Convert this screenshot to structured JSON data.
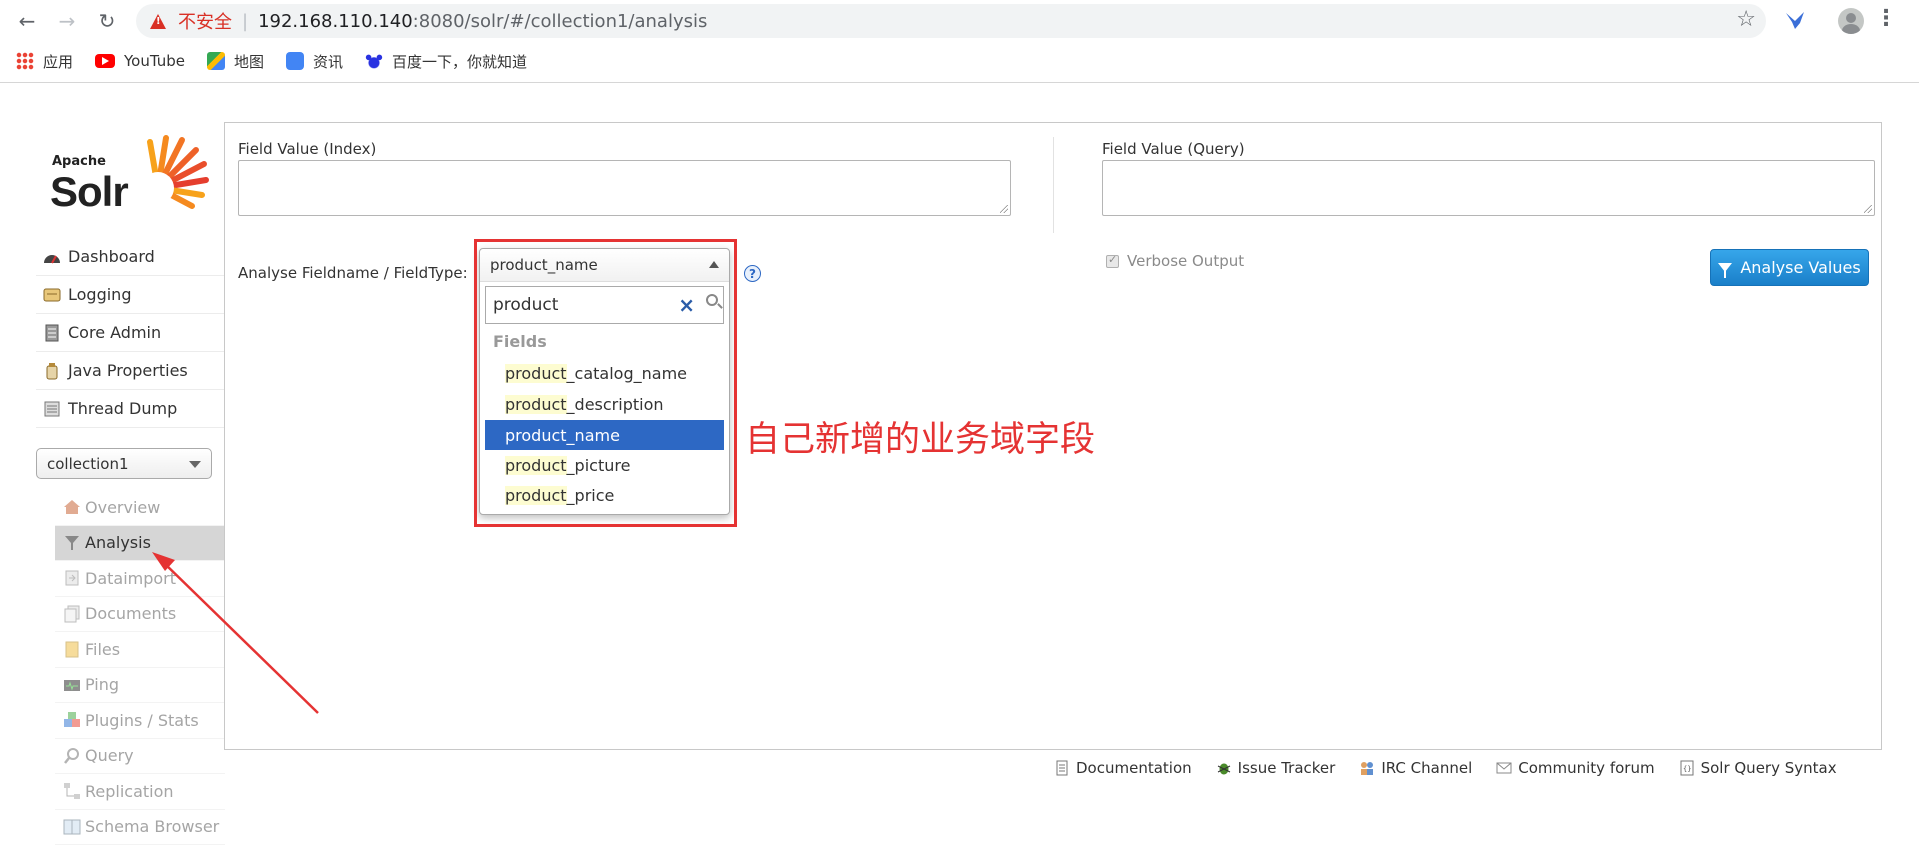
{
  "browser": {
    "insecure_label": "不安全",
    "url_host": "192.168.110.140",
    "url_rest": ":8080/solr/#/collection1/analysis",
    "bookmarks": [
      {
        "label": "应用",
        "icon": "apps-icon"
      },
      {
        "label": "YouTube",
        "icon": "youtube-icon"
      },
      {
        "label": "地图",
        "icon": "maps-icon"
      },
      {
        "label": "资讯",
        "icon": "news-icon"
      },
      {
        "label": "百度一下，你就知道",
        "icon": "baidu-icon"
      }
    ]
  },
  "logo": {
    "apache": "Apache",
    "solr": "Solr"
  },
  "sidebar": {
    "items": [
      {
        "label": "Dashboard",
        "icon": "dashboard-icon"
      },
      {
        "label": "Logging",
        "icon": "logging-icon"
      },
      {
        "label": "Core Admin",
        "icon": "core-admin-icon"
      },
      {
        "label": "Java Properties",
        "icon": "java-icon"
      },
      {
        "label": "Thread Dump",
        "icon": "thread-dump-icon"
      }
    ],
    "core_selector": "collection1",
    "core_items": [
      {
        "label": "Overview",
        "icon": "overview-icon"
      },
      {
        "label": "Analysis",
        "icon": "analysis-icon"
      },
      {
        "label": "Dataimport",
        "icon": "dataimport-icon"
      },
      {
        "label": "Documents",
        "icon": "documents-icon"
      },
      {
        "label": "Files",
        "icon": "files-icon"
      },
      {
        "label": "Ping",
        "icon": "ping-icon"
      },
      {
        "label": "Plugins / Stats",
        "icon": "plugins-icon"
      },
      {
        "label": "Query",
        "icon": "query-icon"
      },
      {
        "label": "Replication",
        "icon": "replication-icon"
      },
      {
        "label": "Schema Browser",
        "icon": "schema-icon"
      }
    ],
    "active_core_item": "Analysis"
  },
  "analysis": {
    "index_label": "Field Value (Index)",
    "index_value": "",
    "query_label": "Field Value (Query)",
    "query_value": "",
    "fieldname_label": "Analyse Fieldname / FieldType:",
    "help": "?",
    "verbose_label": "Verbose Output",
    "verbose_checked": true,
    "analyse_button": "Analyse Values"
  },
  "dropdown": {
    "selected": "product_name",
    "search_value": "product",
    "group_label": "Fields",
    "options": [
      {
        "match": "product",
        "rest": "_catalog_name"
      },
      {
        "match": "product",
        "rest": "_description"
      },
      {
        "match": "product",
        "rest": "_name"
      },
      {
        "match": "product",
        "rest": "_picture"
      },
      {
        "match": "product",
        "rest": "_price"
      }
    ],
    "highlighted_index": 2
  },
  "annotation": {
    "text": "自己新增的业务域字段",
    "color": "#e53333"
  },
  "footer": {
    "links": [
      {
        "label": "Documentation",
        "icon": "documentation-icon"
      },
      {
        "label": "Issue Tracker",
        "icon": "bug-icon"
      },
      {
        "label": "IRC Channel",
        "icon": "irc-icon"
      },
      {
        "label": "Community forum",
        "icon": "mail-icon"
      },
      {
        "label": "Solr Query Syntax",
        "icon": "query-syntax-icon"
      }
    ]
  },
  "colors": {
    "accent": "#2d68c4",
    "button": "#1a7fc9",
    "warning": "#d93025"
  }
}
